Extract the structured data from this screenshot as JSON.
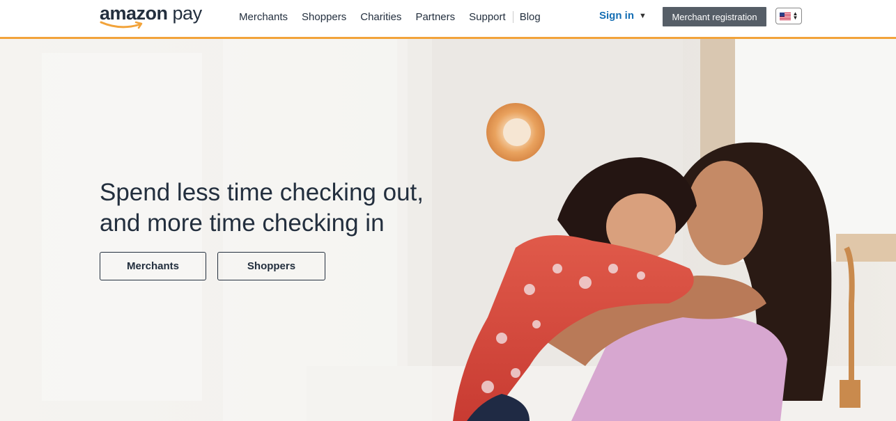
{
  "brand": {
    "logo_bold": "amazon",
    "logo_light": " pay"
  },
  "nav": {
    "items": [
      {
        "label": "Merchants"
      },
      {
        "label": "Shoppers"
      },
      {
        "label": "Charities"
      },
      {
        "label": "Partners"
      },
      {
        "label": "Support"
      },
      {
        "label": "Blog"
      }
    ]
  },
  "account": {
    "signin_label": "Sign in",
    "signin_caret": "▼"
  },
  "header_cta": {
    "merchant_registration": "Merchant registration"
  },
  "locale": {
    "selected": "US",
    "icon": "us-flag-icon"
  },
  "hero": {
    "headline_line1": "Spend less time checking out,",
    "headline_line2": "and more time checking in",
    "buttons": [
      {
        "label": "Merchants"
      },
      {
        "label": "Shoppers"
      }
    ]
  },
  "colors": {
    "accent": "#f2a33a",
    "signin": "#146eb4",
    "text": "#232f3e",
    "merchant_btn_bg": "#565e67"
  }
}
